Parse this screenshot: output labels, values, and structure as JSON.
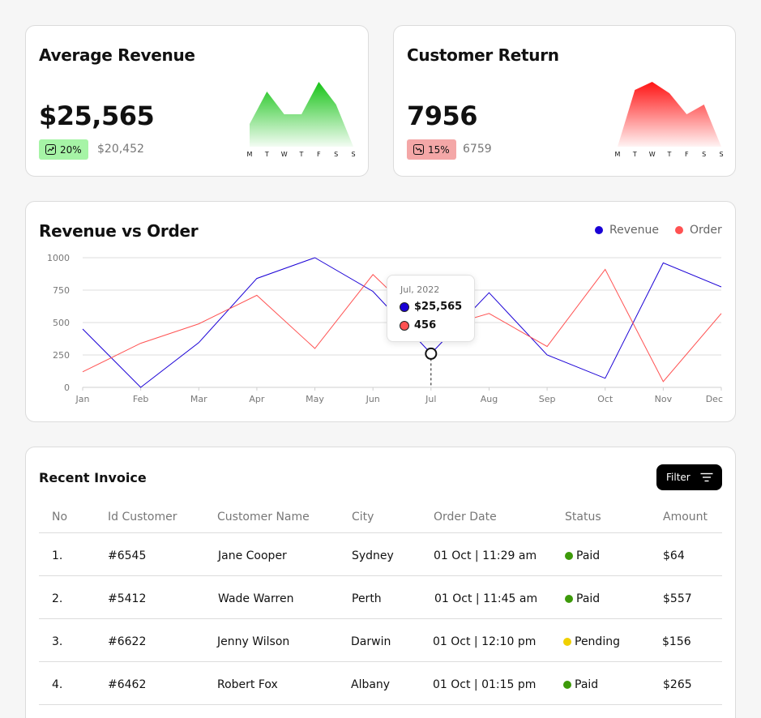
{
  "kpis": [
    {
      "title": "Average Revenue",
      "value": "$25,565",
      "change": "20%",
      "trend": "up",
      "previous": "$20,452",
      "color": "#17c317",
      "badge_bg": "#a6f4a6",
      "days": [
        "M",
        "T",
        "W",
        "T",
        "F",
        "S",
        "S"
      ],
      "spark": [
        28,
        68,
        40,
        40,
        80,
        52,
        0
      ]
    },
    {
      "title": "Customer Return",
      "value": "7956",
      "change": "15%",
      "trend": "down",
      "previous": "6759",
      "color": "#ff1414",
      "badge_bg": "#f4a7a7",
      "days": [
        "M",
        "T",
        "W",
        "T",
        "F",
        "S",
        "S"
      ],
      "spark": [
        0,
        70,
        80,
        66,
        40,
        52,
        0
      ]
    }
  ],
  "chart_section": {
    "title": "Revenue vs Order",
    "legend": [
      {
        "label": "Revenue",
        "color": "#1a00d6"
      },
      {
        "label": "Order",
        "color": "#ff5252"
      }
    ]
  },
  "chart_data": {
    "type": "line",
    "title": "Revenue vs Order",
    "categories": [
      "Jan",
      "Feb",
      "Mar",
      "Apr",
      "May",
      "Jun",
      "Jul",
      "Aug",
      "Sep",
      "Oct",
      "Nov",
      "Dec"
    ],
    "ylim": [
      0,
      1000
    ],
    "yticks": [
      "0",
      "250",
      "500",
      "750",
      "1000"
    ],
    "grid": true,
    "legend_position": "top-right",
    "series": [
      {
        "name": "Revenue",
        "color": "#1a00d6",
        "values": [
          450,
          0,
          345,
          840,
          1000,
          740,
          260,
          730,
          250,
          70,
          960,
          775
        ]
      },
      {
        "name": "Order",
        "color": "#ff5252",
        "values": [
          120,
          340,
          490,
          710,
          300,
          870,
          440,
          570,
          315,
          910,
          45,
          570
        ]
      }
    ],
    "highlight": {
      "category": "Jul",
      "value": 260
    }
  },
  "tooltip": {
    "date": "Jul, 2022",
    "rows": [
      {
        "value": "$25,565",
        "color": "#1a00d6"
      },
      {
        "value": "456",
        "color": "#ff5252"
      }
    ]
  },
  "invoice": {
    "title": "Recent Invoice",
    "filter_label": "Filter",
    "columns": [
      "No",
      "Id Customer",
      "Customer Name",
      "City",
      "Order Date",
      "Status",
      "Amount"
    ],
    "rows": [
      {
        "no": "1.",
        "id": "#6545",
        "name": "Jane Cooper",
        "city": "Sydney",
        "date": "01 Oct | 11:29 am",
        "status": "Paid",
        "status_color": "#3d9a0a",
        "amount": "$64"
      },
      {
        "no": "2.",
        "id": "#5412",
        "name": "Wade Warren",
        "city": "Perth",
        "date": "01 Oct | 11:45 am",
        "status": "Paid",
        "status_color": "#3d9a0a",
        "amount": "$557"
      },
      {
        "no": "3.",
        "id": "#6622",
        "name": "Jenny Wilson",
        "city": "Darwin",
        "date": "01 Oct | 12:10 pm",
        "status": "Pending",
        "status_color": "#f0d000",
        "amount": "$156"
      },
      {
        "no": "4.",
        "id": "#6462",
        "name": "Robert Fox",
        "city": "Albany",
        "date": "01 Oct | 01:15 pm",
        "status": "Paid",
        "status_color": "#3d9a0a",
        "amount": "$265"
      }
    ]
  }
}
